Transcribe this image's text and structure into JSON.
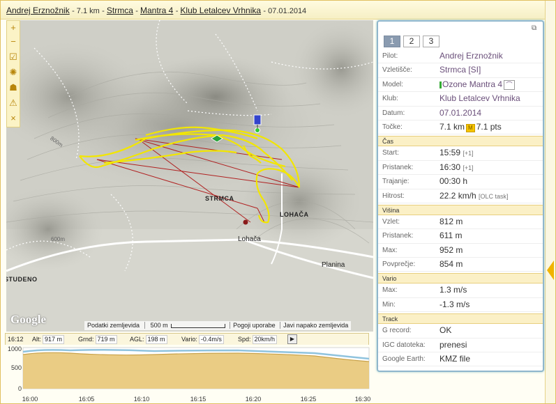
{
  "header": {
    "pilot": "Andrej Erznožnik",
    "distance": "7.1 km",
    "site": "Strmca",
    "glider": "Mantra 4",
    "club": "Klub Letalcev Vrhnika",
    "date": "07.01.2014",
    "sep": "-"
  },
  "map": {
    "toolbar": [
      "+",
      "−",
      "☑",
      "✺",
      "☗",
      "⚠",
      "×"
    ],
    "labels": {
      "strmca": "STRMCA",
      "lohaca": "LOHAČA",
      "studeno": "STUDENO",
      "road_lohaca": "Lohača",
      "road_planina": "Planina",
      "contour_800": "800m",
      "contour_600": "600m"
    },
    "google": "Google",
    "footer": {
      "data": "Podatki zemljevida",
      "scale": "500 m",
      "terms": "Pogoji uporabe",
      "report": "Javi napako zemljevida"
    }
  },
  "databar": {
    "time": "16:12",
    "alt_label": "Alt:",
    "alt": "917 m",
    "grnd_label": "Grnd:",
    "grnd": "719 m",
    "agl_label": "AGL:",
    "agl": "198 m",
    "vario_label": "Vario:",
    "vario": "-0.4m/s",
    "spd_label": "Spd:",
    "spd": "20km/h",
    "play": "▶"
  },
  "profile": {
    "y_ticks": [
      "1000",
      "500",
      "0"
    ],
    "x_ticks": [
      "16:00",
      "16:05",
      "16:10",
      "16:15",
      "16:20",
      "16:25",
      "16:30"
    ],
    "colors": {
      "ground": "#e8c677",
      "ground_line": "#c9a24a",
      "flight": "#8fc3de"
    }
  },
  "panel": {
    "tabs": [
      "1",
      "2",
      "3"
    ],
    "active_tab": 0,
    "rows_top": [
      {
        "k": "Pilot:",
        "v": "Andrej Erznožnik"
      },
      {
        "k": "Vzletišče:",
        "v": "Strmca [SI]"
      },
      {
        "k": "Model:",
        "v": "Ozone Mantra 4"
      },
      {
        "k": "Klub:",
        "v": "Klub Letalcev Vrhnika"
      },
      {
        "k": "Datum:",
        "v": "07.01.2014"
      },
      {
        "k": "Točke:",
        "v": "7.1 km",
        "badge": "M",
        "v2": "7.1 pts"
      }
    ],
    "sections": {
      "cas": "Čas",
      "visina": "Višina",
      "vario": "Vario",
      "track": "Track"
    },
    "cas": [
      {
        "k": "Start:",
        "v": "15:59",
        "sub": "[+1]"
      },
      {
        "k": "Pristanek:",
        "v": "16:30",
        "sub": "[+1]"
      },
      {
        "k": "Trajanje:",
        "v": "00:30 h"
      },
      {
        "k": "Hitrost:",
        "v": "22.2 km/h",
        "sub": "[OLC task]"
      }
    ],
    "visina": [
      {
        "k": "Vzlet:",
        "v": "812 m"
      },
      {
        "k": "Pristanek:",
        "v": "611 m"
      },
      {
        "k": "Max:",
        "v": "952 m"
      },
      {
        "k": "Povprečje:",
        "v": "854 m"
      }
    ],
    "vario": [
      {
        "k": "Max:",
        "v": "1.3 m/s"
      },
      {
        "k": "Min:",
        "v": "-1.3 m/s"
      }
    ],
    "track": [
      {
        "k": "G record:",
        "v": "OK"
      },
      {
        "k": "IGC datoteka:",
        "v": "prenesi"
      },
      {
        "k": "Google Earth:",
        "v": "KMZ file"
      }
    ]
  }
}
